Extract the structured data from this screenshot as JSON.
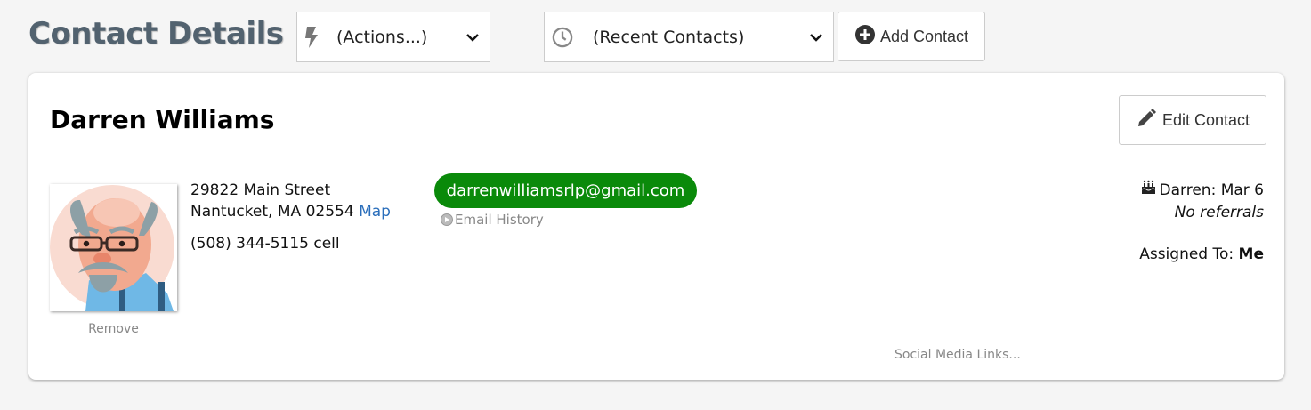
{
  "header": {
    "title": "Contact Details",
    "actions_label": "(Actions...)",
    "recent_label": "(Recent Contacts)",
    "add_contact_label": "Add Contact"
  },
  "icons": {
    "actions": "lightning-icon",
    "recent": "clock-icon",
    "add": "plus-circle-icon",
    "edit": "pencil-icon",
    "birthday": "cake-icon",
    "dropdown": "chevron-down-icon"
  },
  "contact": {
    "name": "Darren Williams",
    "edit_label": "Edit Contact",
    "remove_label": "Remove",
    "address_line1": "29822 Main Street",
    "address_line2": "Nantucket, MA 02554",
    "map_label": "Map",
    "phone": "(508) 344-5115 cell",
    "email": "darrenwilliamsrlp@gmail.com",
    "email_history_label": "Email History",
    "birthday": "Darren: Mar 6",
    "referrals": "No referrals",
    "assigned_label": "Assigned To:",
    "assigned_value": "Me",
    "social_label": "Social Media Links..."
  },
  "colors": {
    "title": "#52626f",
    "email_pill": "#0a8a0a",
    "link": "#2a6ebb"
  }
}
